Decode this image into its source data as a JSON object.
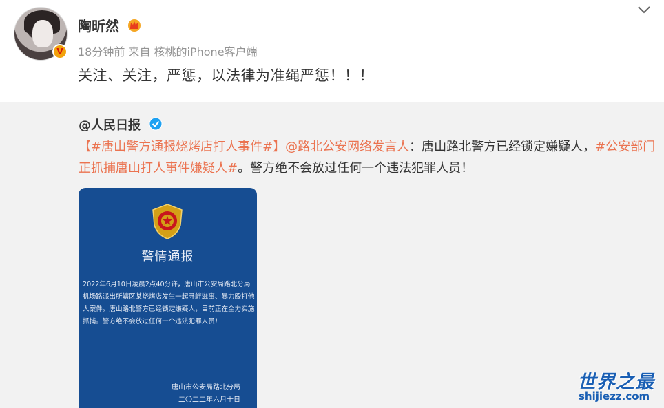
{
  "post": {
    "username": "陶昕然",
    "meta": "18分钟前  来自 核桃的iPhone客户端",
    "text": "关注、关注，严惩，以法律为准绳严惩！！！"
  },
  "icons": {
    "crown": "crown-icon",
    "verified_badge": "verified-v-icon",
    "chevron": "chevron-down-icon",
    "blue_v": "blue-verified-icon",
    "emblem": "police-emblem-icon"
  },
  "colors": {
    "link": "#eb7350",
    "repost_bg": "#f2f2f2",
    "notice_bg": "#164d92"
  },
  "repost": {
    "author": "@人民日报",
    "parts": {
      "bracket_open": "【",
      "topic1": "#唐山警方通报烧烤店打人事件#",
      "bracket_close": "】",
      "mention": "@路北公安网络发言人",
      "text1": "：唐山路北警方已经锁定嫌疑人，",
      "topic2": "#公安部门正抓捕唐山打人事件嫌疑人#",
      "text2": "。警方绝不会放过任何一个违法犯罪人员！"
    }
  },
  "notice": {
    "vbadge": "V",
    "title": "警情通报",
    "body": "    2022年6月10日凌晨2点40分许，唐山市公安局路北分局机场路派出所辖区某烧烤店发生一起寻衅滋事、暴力殴打他人案件。唐山路北警方已经锁定嫌疑人，目前正在全力实施抓捕。警方绝不会放过任何一个违法犯罪人员！",
    "sign": "唐山市公安局路北分局\n二〇二二年六月十日"
  },
  "watermark": {
    "title": "世界之最",
    "url": "shijiezz.com"
  }
}
